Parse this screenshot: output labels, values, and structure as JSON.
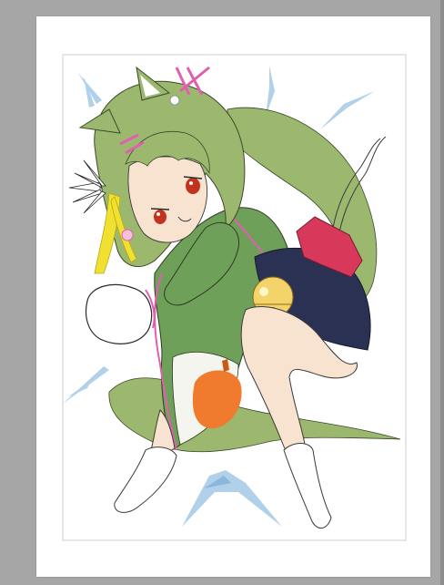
{
  "canvas": {
    "background_color": "#a6a6a6",
    "paper_color": "#ffffff",
    "frame_color": "#cfcfcf"
  },
  "artwork": {
    "subject_icon": "catgirl-character-sketch",
    "palette": {
      "hair": "#9cb86e",
      "hair_shadow": "#8aa85e",
      "coat": "#6fa05a",
      "skin": "#f7e3cf",
      "bow": "#d8395a",
      "bell": "#f3d46a",
      "shorts": "#2a3152",
      "pumpkin": "#f07a2e",
      "feather": "#f0e030",
      "accent_pink": "#e05fb0",
      "streak_blue": "#a9cbe8",
      "eye": "#c2331f",
      "lineart": "#2b2b2b"
    }
  }
}
